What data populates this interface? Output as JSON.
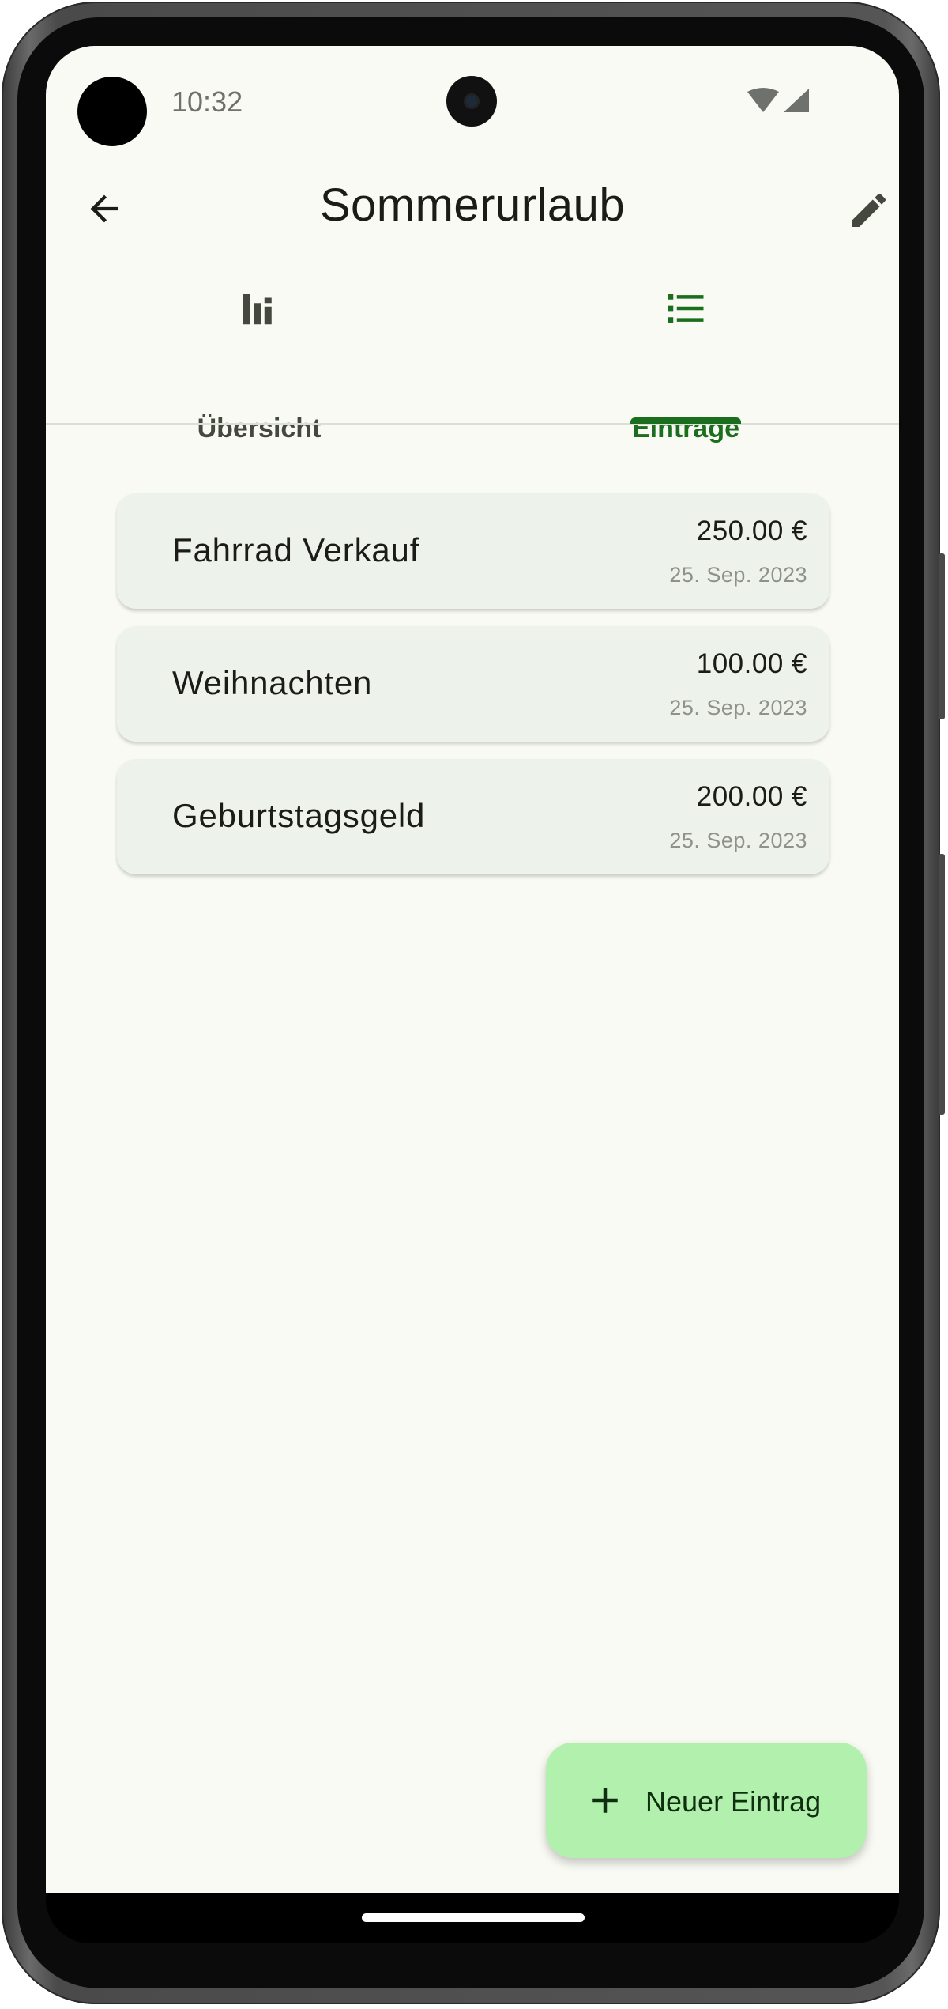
{
  "status_bar": {
    "time": "10:32",
    "icons": [
      "wifi-icon",
      "cellular-signal-icon"
    ]
  },
  "app_bar": {
    "title": "Sommerurlaub",
    "back_icon": "arrow-back-icon",
    "edit_icon": "pencil-icon"
  },
  "tabs": [
    {
      "label": "Übersicht",
      "icon": "bar-chart-icon",
      "active": false
    },
    {
      "label": "Einträge",
      "icon": "list-icon",
      "active": true
    }
  ],
  "entries": [
    {
      "name": "Fahrrad Verkauf",
      "amount": "250.00 €",
      "date": "25. Sep. 2023"
    },
    {
      "name": "Weihnachten",
      "amount": "100.00 €",
      "date": "25. Sep. 2023"
    },
    {
      "name": "Geburtstagsgeld",
      "amount": "200.00 €",
      "date": "25. Sep. 2023"
    }
  ],
  "fab": {
    "label": "Neuer Eintrag",
    "icon": "plus-icon"
  },
  "colors": {
    "primary": "#1b6e1d",
    "background": "#f9faf4",
    "card": "#edf2ea",
    "fab": "#b2f0ad"
  }
}
